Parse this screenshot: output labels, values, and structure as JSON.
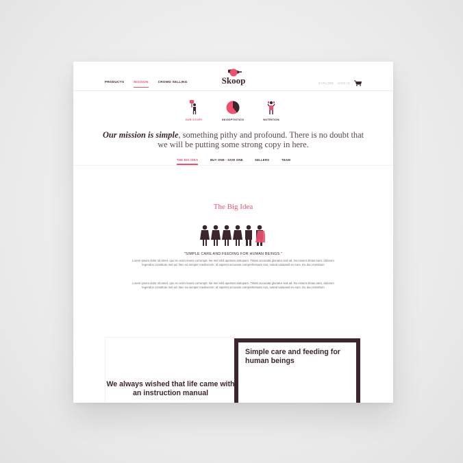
{
  "header": {
    "nav": [
      "PRODUCTS",
      "MISSION",
      "CROWD SELLING"
    ],
    "active_nav": "MISSION",
    "logo_text": "Skoop",
    "right_links": [
      "EXPLORE",
      "SIGN IN"
    ],
    "cart_icon": "cart-icon"
  },
  "subnav": {
    "items": [
      {
        "label": "OUR STORY",
        "icon": "person-sign-icon",
        "active": true
      },
      {
        "label": "SKOOPTISTICS",
        "icon": "pie-chart-icon",
        "active": false
      },
      {
        "label": "NUTRITION",
        "icon": "person-trophy-icon",
        "active": false
      }
    ]
  },
  "mission": {
    "lead": "Our mission is simple",
    "rest": ", something pithy and profound. There is no doubt that we will be putting some strong copy in here."
  },
  "tabs": [
    "THE BIG IDEA",
    "BUY ONE - GIVE ONE",
    "SELLERS",
    "TEAM"
  ],
  "active_tab": "THE BIG IDEA",
  "big_idea": {
    "title": "The Big Idea",
    "quote": "\"SIMPLE CARE AND FEEDING FOR HUMAN BEINGS.\"",
    "paragraphs": [
      "Lorem ipsum dolor sit amet, quo no enim inveni corrumpit. Ne mel nihil aperiam antiopam. Tritani accusata gloriatur sed ad. No essent dictas eam, dolorum legendos constituto mel ad. Nec ea semper mediocrem. Id saperet accusam comprehensam eos, soleat salutandi ex eum. Eu duo mentitum",
      "Lorem ipsum dolor sit amet, quo no enim inveni corrumpit. Ne mel nihil aperiam antiopam. Tritani accusata gloriatur sed ad. No essent dictas eam, dolorum legendos constituto mel ad. Nec ea semper mediocrem. Id saperet accusam comprehensam eos, soleat salutandi ex eum. Eu duo mentitum"
    ]
  },
  "bottom": {
    "left_text": "We always wished that life came with an instruction manual",
    "right_text": "Simple care and feeding for human beings"
  },
  "colors": {
    "accent": "#f0506e",
    "dark": "#3d2530"
  }
}
